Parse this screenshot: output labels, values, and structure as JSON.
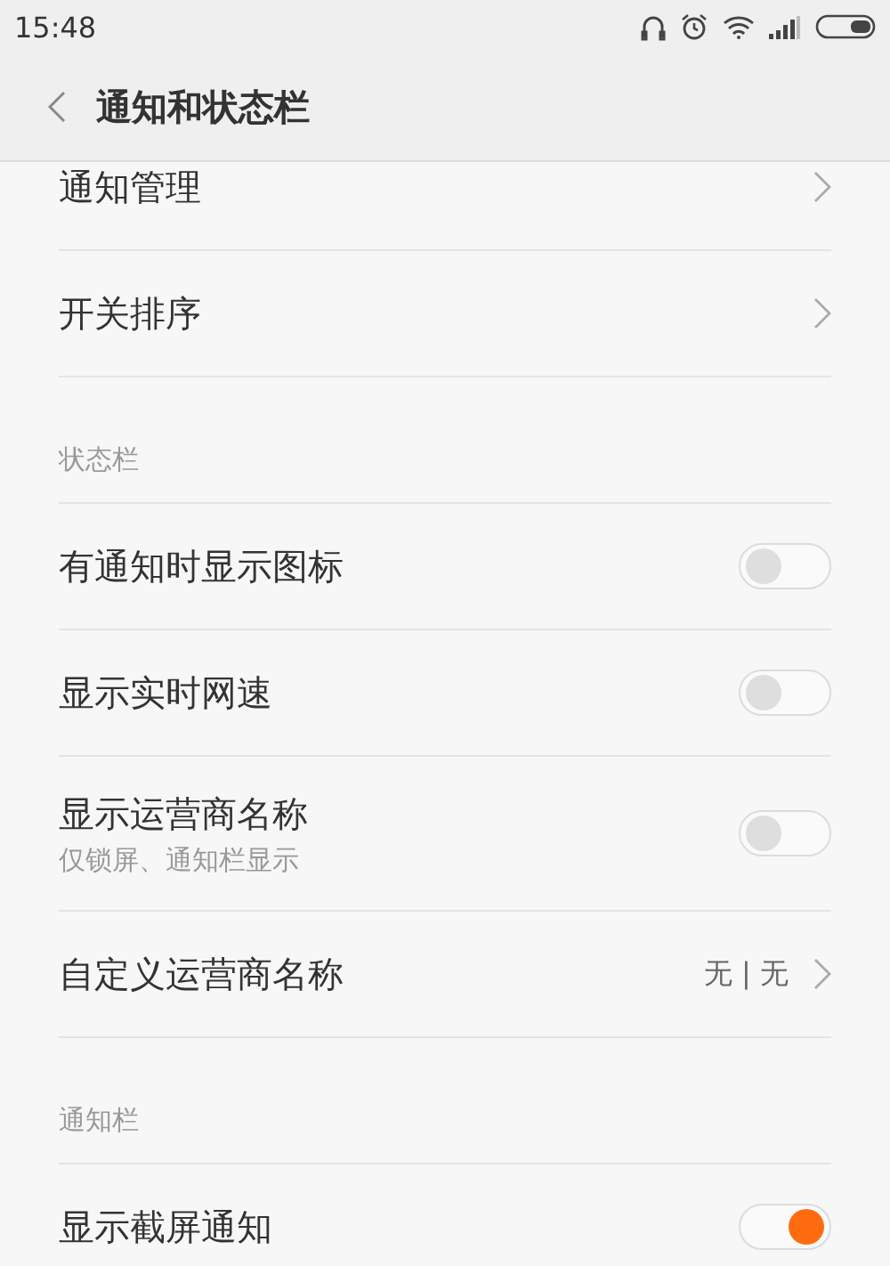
{
  "status_bar": {
    "time": "15:48"
  },
  "header": {
    "title": "通知和状态栏"
  },
  "sections": [
    {
      "items": [
        {
          "kind": "link",
          "label": "通知管理"
        },
        {
          "kind": "link",
          "label": "开关排序"
        }
      ]
    },
    {
      "title": "状态栏",
      "items": [
        {
          "kind": "toggle",
          "label": "有通知时显示图标",
          "on": false
        },
        {
          "kind": "toggle",
          "label": "显示实时网速",
          "on": false
        },
        {
          "kind": "toggle",
          "label": "显示运营商名称",
          "sublabel": "仅锁屏、通知栏显示",
          "on": false
        },
        {
          "kind": "link",
          "label": "自定义运营商名称",
          "value": "无 | 无"
        }
      ]
    },
    {
      "title": "通知栏",
      "items": [
        {
          "kind": "toggle",
          "label": "显示截屏通知",
          "on": true
        }
      ]
    }
  ]
}
